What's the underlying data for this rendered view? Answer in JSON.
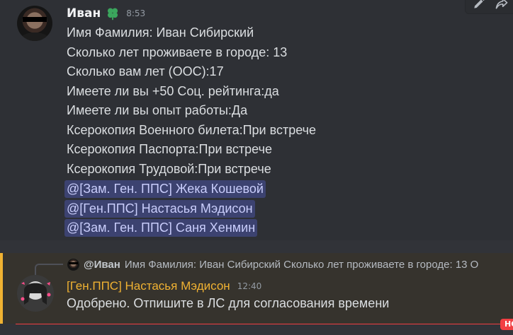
{
  "message1": {
    "author": "Иван",
    "author_icon": "clover-icon",
    "time": "8:53",
    "lines": [
      "Имя Фамилия: Иван Сибирский",
      "Сколько лет проживаете в городе: 13",
      "Сколько вам лет (ООС):17",
      "Имеете ли вы +50 Соц. рейтинга:да",
      "Имеете ли вы опыт работы:Да",
      "Ксерокопия Военного билета:При встрече",
      "Ксерокопия Паспорта:При встрече",
      "Ксерокопия Трудовой:При встрече"
    ],
    "mentions": [
      "@[Зам. Ген. ППС] Жека Кошевой",
      "@[Ген.ППС] Настасья Мэдисон",
      "@[Зам. Ген. ППС] Саня Хенмин"
    ]
  },
  "toolbar": {
    "icons": [
      "edit-icon",
      "forward-icon"
    ]
  },
  "message2": {
    "reply_author": "@Иван",
    "reply_text": "Имя Фамилия: Иван Сибирский  Сколько лет проживаете в городе: 13 О",
    "author": "[Ген.ППС] Настасья Мэдисон",
    "time": "12:40",
    "text": "Одобрено. Отпишите в ЛС для согласования времени"
  },
  "new_badge": "НО",
  "colors": {
    "background": "#313338",
    "hover": "#2e3035",
    "mention_bg": "#3c4270",
    "mention_text": "#c9cdfb",
    "highlight_bg": "#36332d",
    "highlight_border": "#f0b232",
    "author2": "#f0b232",
    "new_divider": "#f23f43"
  }
}
